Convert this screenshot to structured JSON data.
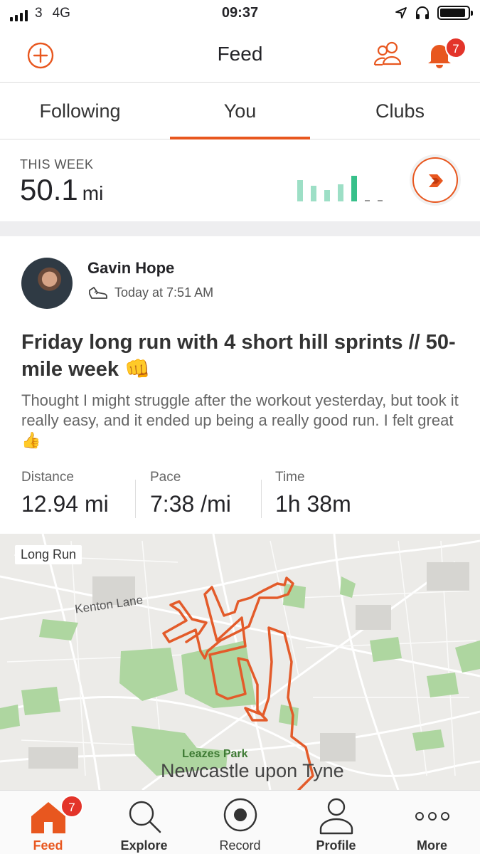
{
  "status_bar": {
    "carrier": "3",
    "network": "4G",
    "time": "09:37"
  },
  "header": {
    "title": "Feed",
    "notification_count": "7"
  },
  "tabs": [
    {
      "label": "Following",
      "active": false
    },
    {
      "label": "You",
      "active": true
    },
    {
      "label": "Clubs",
      "active": false
    }
  ],
  "this_week": {
    "label": "THIS WEEK",
    "value": "50.1",
    "unit": "mi"
  },
  "activity": {
    "athlete": "Gavin Hope",
    "time": "Today at 7:51 AM",
    "title": "Friday long run with 4 short hill sprints // 50-mile week 👊",
    "description": "Thought I might struggle after the workout yesterday, but took it really easy, and it ended up being a really good run. I felt great 👍",
    "stats": [
      {
        "label": "Distance",
        "value": "12.94 mi"
      },
      {
        "label": "Pace",
        "value": "7:38 /mi"
      },
      {
        "label": "Time",
        "value": "1h 38m"
      }
    ],
    "map": {
      "tag": "Long Run",
      "labels": {
        "road": "Kenton Lane",
        "park": "Leazes Park",
        "city": "Newcastle upon Tyne"
      }
    }
  },
  "bottom_nav": {
    "items": [
      {
        "label": "Feed",
        "active": true
      },
      {
        "label": "Explore",
        "active": false
      },
      {
        "label": "Record",
        "active": false
      },
      {
        "label": "Profile",
        "active": false
      },
      {
        "label": "More",
        "active": false
      }
    ],
    "feed_badge": "7"
  },
  "colors": {
    "accent": "#e8571f",
    "chart_light": "#9ddfc6",
    "chart_dark": "#37c08a",
    "route": "#e35b2a"
  }
}
